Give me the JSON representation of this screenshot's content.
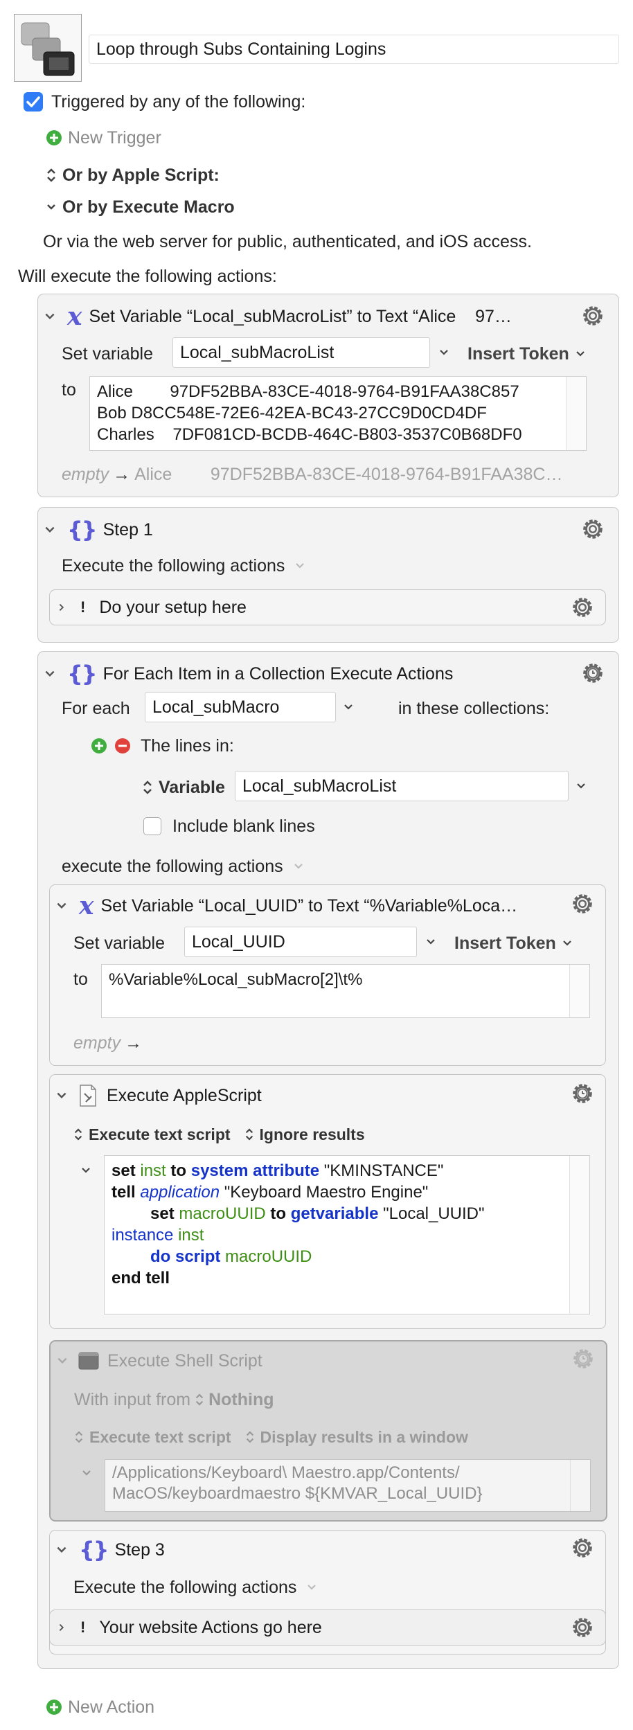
{
  "macro": {
    "name": "Loop through Subs Containing Logins"
  },
  "trigger": {
    "checkbox_label": "Triggered by any of the following:",
    "new_trigger": "New Trigger",
    "apple_script": "Or by Apple Script:",
    "execute_macro": "Or by Execute Macro",
    "web_server": "Or via the web server for public, authenticated, and iOS access."
  },
  "will_execute": "Will execute the following actions:",
  "action1": {
    "title": "Set Variable “Local_subMacroList” to Text “Alice    97…",
    "set_variable_label": "Set variable",
    "variable_value": "Local_subMacroList",
    "insert_token": "Insert Token",
    "to_label": "to",
    "text_lines": [
      "Alice        97DF52BBA-83CE-4018-9764-B91FAA38C857",
      "Bob D8CC548E-72E6-42EA-BC43-27CC9D0CD4DF",
      "Charles    7DF081CD-BCDB-464C-B803-3537C0B68DF0"
    ],
    "preview_empty": "empty",
    "preview_arrow": "→",
    "preview_text": "Alice        97DF52BBA-83CE-4018-9764-B91FAA38C…"
  },
  "step1": {
    "title": "Step 1",
    "execute_label": "Execute the following actions",
    "inner_title": "Do your setup here"
  },
  "foreach": {
    "title": "For Each Item in a Collection Execute Actions",
    "for_each_label": "For each",
    "var_value": "Local_subMacro",
    "in_collections": "in these collections:",
    "lines_in": "The lines in:",
    "variable_label": "Variable",
    "variable_value": "Local_subMacroList",
    "include_blank": "Include blank lines",
    "execute_label": "execute the following actions"
  },
  "action_uuid": {
    "title": "Set Variable “Local_UUID” to Text “%Variable%Loca…",
    "set_variable_label": "Set variable",
    "variable_value": "Local_UUID",
    "insert_token": "Insert Token",
    "to_label": "to",
    "text": "%Variable%Local_subMacro[2]\\t%",
    "preview_empty": "empty",
    "preview_arrow": "→"
  },
  "applescript": {
    "title": "Execute AppleScript",
    "execute_text_script": "Execute text script",
    "ignore_results": "Ignore results",
    "code": {
      "l1_set": "set",
      "l1_inst": "inst",
      "l1_to": "to",
      "l1_sysattr": "system attribute",
      "l1_str": "\"KMINSTANCE\"",
      "l2_tell": "tell",
      "l2_app": "application",
      "l2_str": "\"Keyboard Maestro Engine\"",
      "l3_set": "set",
      "l3_var": "macroUUID",
      "l3_to": "to",
      "l3_getvar": "getvariable",
      "l3_str": "\"Local_UUID\"",
      "l4_instance": "instance",
      "l4_inst": "inst",
      "l5_do": "do script",
      "l5_var": "macroUUID",
      "l6_end": "end tell"
    }
  },
  "shell": {
    "title": "Execute Shell Script",
    "with_input_from": "With input from",
    "nothing": "Nothing",
    "execute_text_script": "Execute text script",
    "display_results": "Display results in a window",
    "script_lines": [
      "/Applications/Keyboard\\ Maestro.app/Contents/",
      "MacOS/keyboardmaestro ${KMVAR_Local_UUID}"
    ]
  },
  "step3": {
    "title": "Step 3",
    "execute_label": "Execute the following actions",
    "inner_title": "Your website Actions go here"
  },
  "new_action": "New Action"
}
